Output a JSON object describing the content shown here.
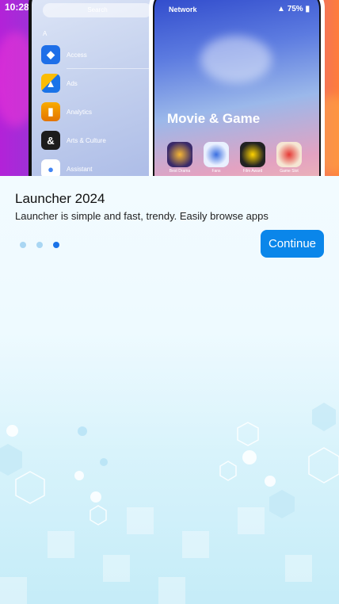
{
  "status_bar": {
    "time": "10:28"
  },
  "hero": {
    "left_phone": {
      "search_placeholder": "Search",
      "index_letter": "A",
      "apps": [
        {
          "label": "Access",
          "icon": "access-icon",
          "color": "#1e6fe8",
          "glyph": "◆"
        },
        {
          "label": "Ads",
          "icon": "ads-icon",
          "color": "#f4b400",
          "glyph": "▲"
        },
        {
          "label": "Analytics",
          "icon": "analytics-icon",
          "color": "#e37400",
          "glyph": "▮"
        },
        {
          "label": "Arts & Culture",
          "icon": "arts-culture-icon",
          "color": "#1c1c1c",
          "glyph": "&"
        },
        {
          "label": "Assistant",
          "icon": "assistant-icon",
          "color": "#ffffff",
          "glyph": "●"
        }
      ]
    },
    "right_phone": {
      "network_label": "Network",
      "battery": "75%",
      "section_title": "Movie & Game",
      "games": [
        {
          "label": "Best Drama",
          "icon": "best-drama-icon",
          "color": "#3a2a6a"
        },
        {
          "label": "Fans",
          "icon": "fans-icon",
          "color": "#e9f0ff"
        },
        {
          "label": "Film Award",
          "icon": "film-award-icon",
          "color": "#222222"
        },
        {
          "label": "Game Slot",
          "icon": "game-slot-icon",
          "color": "#f5e6d3"
        }
      ]
    }
  },
  "content": {
    "title": "Launcher 2024",
    "subtitle": "Launcher is simple and fast, trendy. Easily browse apps"
  },
  "pager": {
    "count": 3,
    "active_index": 2
  },
  "continue_button": {
    "label": "Continue"
  },
  "colors": {
    "accent": "#0a86ea",
    "dot_active": "#1a73e8",
    "dot_inactive": "#a9d6f3"
  }
}
